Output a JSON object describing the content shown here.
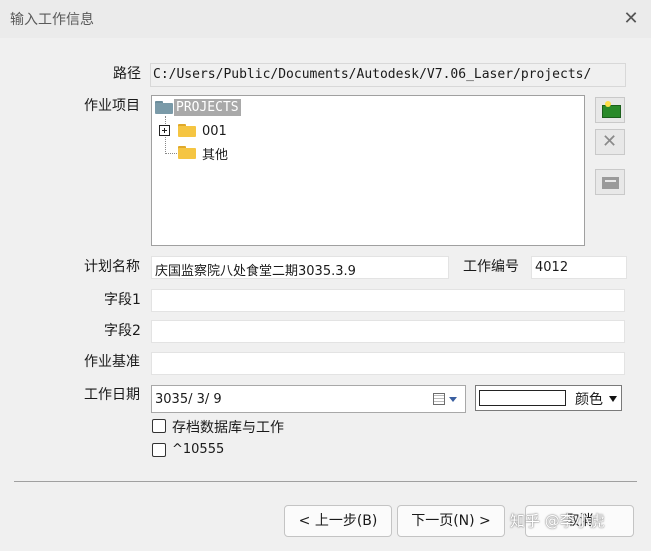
{
  "window": {
    "title": "输入工作信息",
    "close_glyph": "✕"
  },
  "form": {
    "path_label": "路径",
    "path_value": "C:/Users/Public/Documents/Autodesk/V7.06_Laser/projects/",
    "project_label": "作业项目",
    "tree": {
      "root": "PROJECTS",
      "items": [
        {
          "label": "001",
          "expander": "+"
        },
        {
          "label": "其他"
        }
      ]
    },
    "plan_name_label": "计划名称",
    "plan_name_value": "庆国监察院八处食堂二期3035.3.9",
    "job_number_label": "工作编号",
    "job_number_value": "4012",
    "field1_label": "字段1",
    "field1_value": "",
    "field2_label": "字段2",
    "field2_value": "",
    "basis_label": "作业基准",
    "basis_value": "",
    "date_label": "工作日期",
    "date_value": "3035/ 3/ 9",
    "color_label": "颜色",
    "color_swatch": "#ffffff",
    "archive_checkbox_label": "存档数据库与工作",
    "archive_checked": false,
    "code_checkbox_label": "^10555",
    "code_checked": false
  },
  "buttons": {
    "back": "< 上一步(B)",
    "next": "下一页(N) >",
    "cancel": "取消"
  },
  "watermark": "知乎 @李小虎",
  "colors": {
    "folder": "#f5c542",
    "folder_root": "#7a9aa8",
    "selection": "#a9a9a9",
    "add_icon": "#2a8a2a"
  }
}
